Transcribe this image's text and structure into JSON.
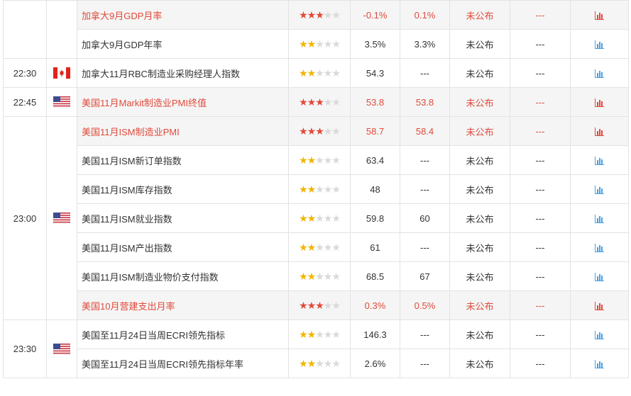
{
  "colors": {
    "highlight_text": "#e04a3a",
    "star_high": "#e04a3a",
    "star_mid": "#f2b400",
    "star_off": "#d9d9d9",
    "chart_red": "#e04a3a",
    "chart_blue": "#4a9fe0"
  },
  "groups": [
    {
      "time": "",
      "flag": "none",
      "rows": [
        {
          "indicator": "加拿大9月GDP月率",
          "importance": 3,
          "previous": "-0.1%",
          "forecast": "0.1%",
          "actual": "未公布",
          "extra": "---",
          "highlight": true
        },
        {
          "indicator": "加拿大9月GDP年率",
          "importance": 2,
          "previous": "3.5%",
          "forecast": "3.3%",
          "actual": "未公布",
          "extra": "---",
          "highlight": false
        }
      ]
    },
    {
      "time": "22:30",
      "flag": "ca",
      "rows": [
        {
          "indicator": "加拿大11月RBC制造业采购经理人指数",
          "importance": 2,
          "previous": "54.3",
          "forecast": "---",
          "actual": "未公布",
          "extra": "---",
          "highlight": false
        }
      ]
    },
    {
      "time": "22:45",
      "flag": "us",
      "rows": [
        {
          "indicator": "美国11月Markit制造业PMI终值",
          "importance": 3,
          "previous": "53.8",
          "forecast": "53.8",
          "actual": "未公布",
          "extra": "---",
          "highlight": true
        }
      ]
    },
    {
      "time": "23:00",
      "flag": "us",
      "rows": [
        {
          "indicator": "美国11月ISM制造业PMI",
          "importance": 3,
          "previous": "58.7",
          "forecast": "58.4",
          "actual": "未公布",
          "extra": "---",
          "highlight": true
        },
        {
          "indicator": "美国11月ISM新订单指数",
          "importance": 2,
          "previous": "63.4",
          "forecast": "---",
          "actual": "未公布",
          "extra": "---",
          "highlight": false
        },
        {
          "indicator": "美国11月ISM库存指数",
          "importance": 2,
          "previous": "48",
          "forecast": "---",
          "actual": "未公布",
          "extra": "---",
          "highlight": false
        },
        {
          "indicator": "美国11月ISM就业指数",
          "importance": 2,
          "previous": "59.8",
          "forecast": "60",
          "actual": "未公布",
          "extra": "---",
          "highlight": false
        },
        {
          "indicator": "美国11月ISM产出指数",
          "importance": 2,
          "previous": "61",
          "forecast": "---",
          "actual": "未公布",
          "extra": "---",
          "highlight": false
        },
        {
          "indicator": "美国11月ISM制造业物价支付指数",
          "importance": 2,
          "previous": "68.5",
          "forecast": "67",
          "actual": "未公布",
          "extra": "---",
          "highlight": false
        },
        {
          "indicator": "美国10月营建支出月率",
          "importance": 3,
          "previous": "0.3%",
          "forecast": "0.5%",
          "actual": "未公布",
          "extra": "---",
          "highlight": true
        }
      ]
    },
    {
      "time": "23:30",
      "flag": "us",
      "rows": [
        {
          "indicator": "美国至11月24日当周ECRI领先指标",
          "importance": 2,
          "previous": "146.3",
          "forecast": "---",
          "actual": "未公布",
          "extra": "---",
          "highlight": false
        },
        {
          "indicator": "美国至11月24日当周ECRI领先指标年率",
          "importance": 2,
          "previous": "2.6%",
          "forecast": "---",
          "actual": "未公布",
          "extra": "---",
          "highlight": false
        }
      ]
    }
  ]
}
